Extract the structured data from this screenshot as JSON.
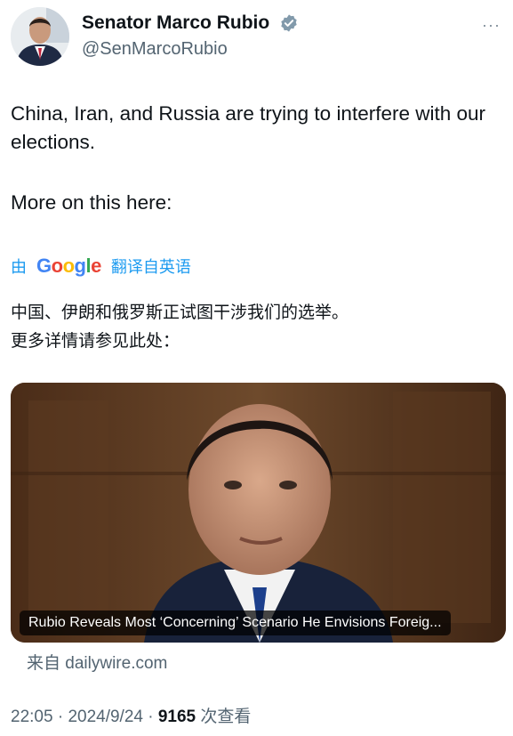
{
  "author": {
    "display_name": "Senator Marco Rubio",
    "handle": "@SenMarcoRubio",
    "verified_icon": "verified-badge-icon",
    "more_label": "···"
  },
  "tweet": {
    "line1": "China, Iran, and Russia are trying to interfere with our elections.",
    "line2": "More on this here:"
  },
  "translation": {
    "by": "由",
    "google": [
      "G",
      "o",
      "o",
      "g",
      "l",
      "e"
    ],
    "google_colors": [
      "#4285F4",
      "#EA4335",
      "#FBBC05",
      "#4285F4",
      "#34A853",
      "#EA4335"
    ],
    "from": "翻译自英语",
    "line1": "中国、伊朗和俄罗斯正试图干涉我们的选举。",
    "line2": "更多详情请参见此处："
  },
  "card": {
    "caption": "Rubio Reveals Most ‘Concerning’ Scenario He Envisions Foreig...",
    "source": "来自 dailywire.com"
  },
  "meta": {
    "time": "22:05",
    "sep1": " · ",
    "date": "2024/9/24",
    "sep2": " · ",
    "views_count": "9165",
    "views_label": " 次查看"
  },
  "colors": {
    "link": "#1d9bf0",
    "secondary": "#536471",
    "primary": "#0f1419"
  }
}
